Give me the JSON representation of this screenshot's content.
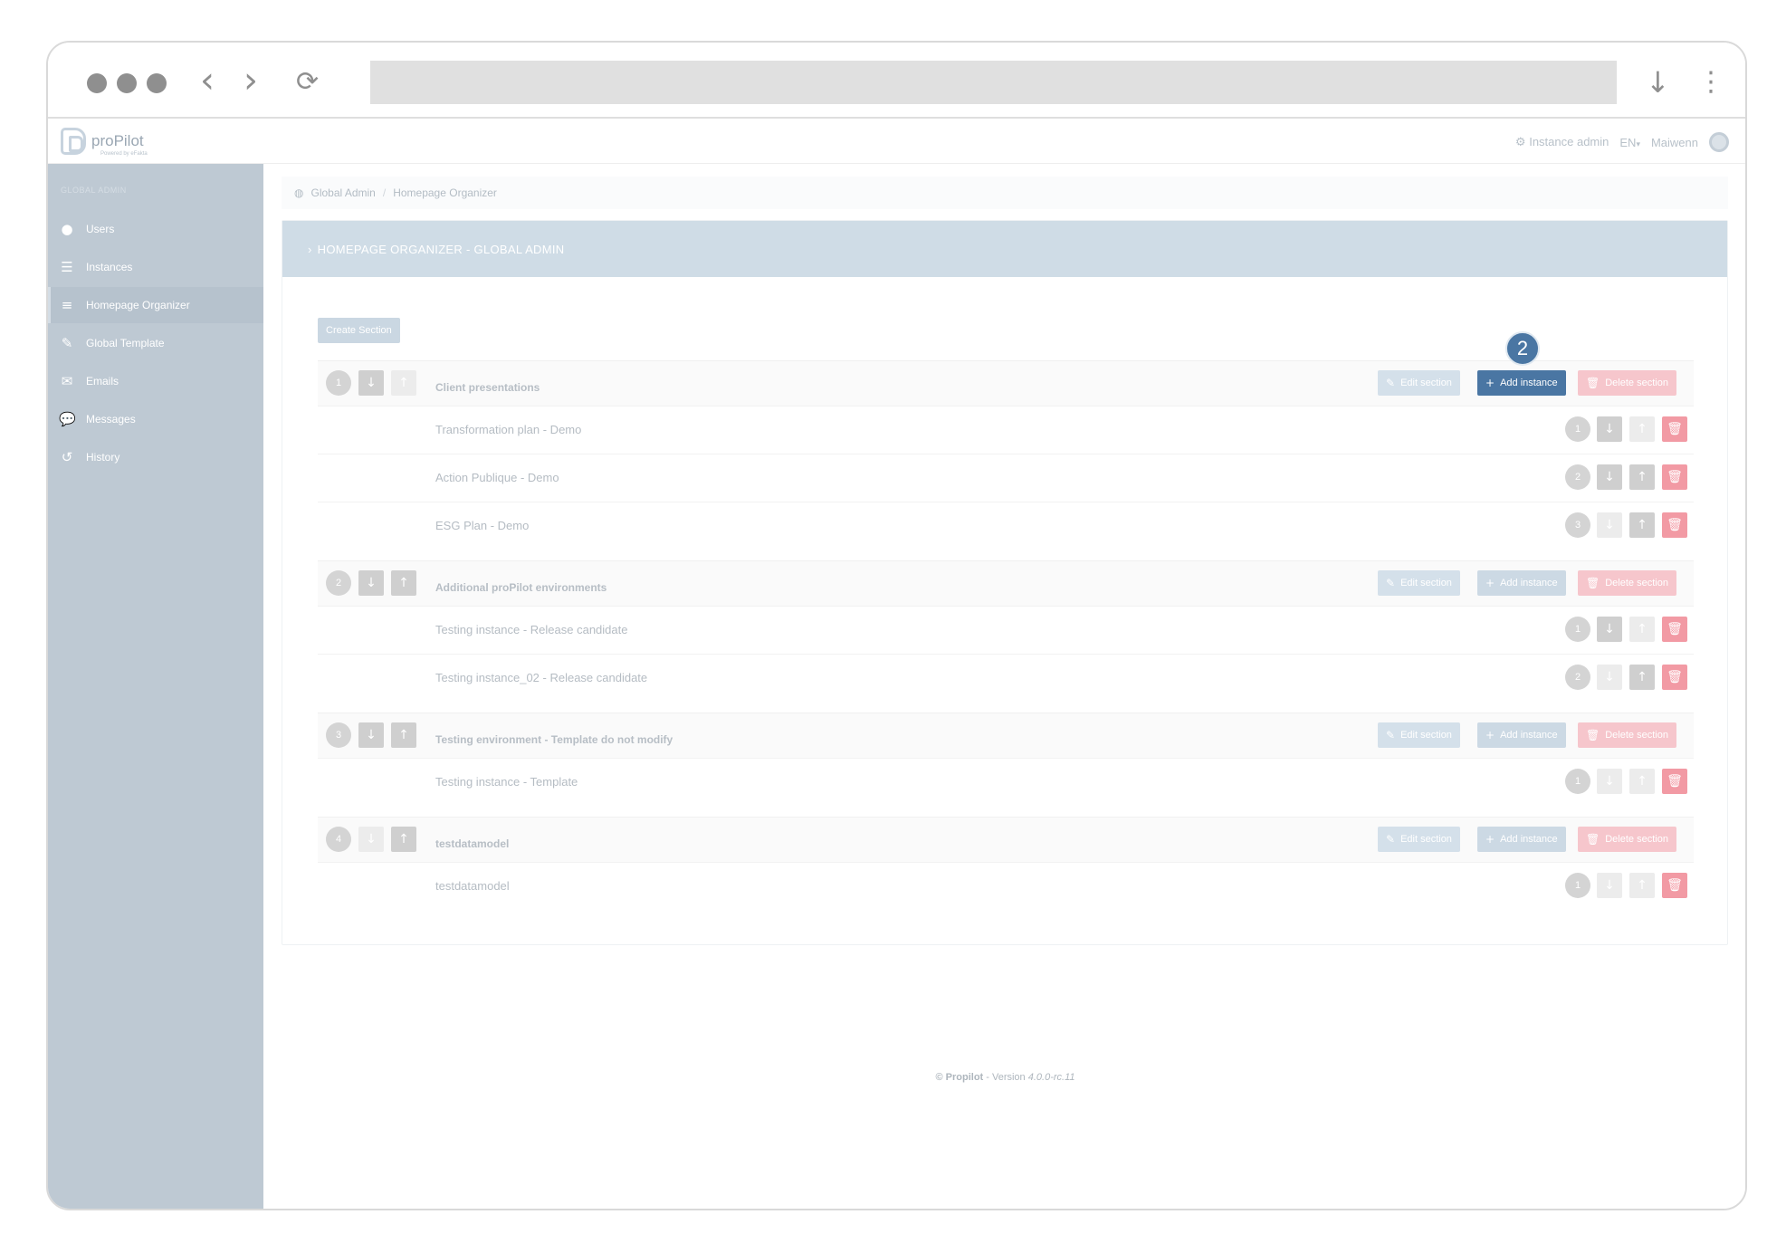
{
  "app": {
    "logo_text": "proPilot",
    "logo_sub": "Powered by eFakta",
    "topbar": {
      "admin_label": "Instance admin",
      "lang": "EN",
      "user": "Maiwenn"
    }
  },
  "sidebar": {
    "heading": "GLOBAL ADMIN",
    "items": [
      {
        "label": "Users",
        "icon": "user-icon"
      },
      {
        "label": "Instances",
        "icon": "list-icon"
      },
      {
        "label": "Homepage Organizer",
        "icon": "bars-icon"
      },
      {
        "label": "Global Template",
        "icon": "brush-icon"
      },
      {
        "label": "Emails",
        "icon": "envelope-icon"
      },
      {
        "label": "Messages",
        "icon": "comment-icon"
      },
      {
        "label": "History",
        "icon": "history-icon"
      }
    ]
  },
  "breadcrumb": {
    "root": "Global Admin",
    "sep": "/",
    "current": "Homepage Organizer"
  },
  "panel": {
    "title": "HOMEPAGE ORGANIZER - GLOBAL ADMIN",
    "create_label": "Create Section"
  },
  "actions": {
    "edit": "Edit section",
    "add": "Add instance",
    "delete": "Delete section"
  },
  "callout": "2",
  "sections": [
    {
      "num": "1",
      "title": "Client presentations",
      "instances": [
        {
          "num": "1",
          "name": "Transformation plan - Demo"
        },
        {
          "num": "2",
          "name": "Action Publique - Demo"
        },
        {
          "num": "3",
          "name": "ESG Plan - Demo"
        }
      ]
    },
    {
      "num": "2",
      "title": "Additional proPilot environments",
      "instances": [
        {
          "num": "1",
          "name": "Testing instance - Release candidate"
        },
        {
          "num": "2",
          "name": "Testing instance_02 - Release candidate"
        }
      ]
    },
    {
      "num": "3",
      "title": "Testing environment - Template do not modify",
      "instances": [
        {
          "num": "1",
          "name": "Testing instance - Template"
        }
      ]
    },
    {
      "num": "4",
      "title": "testdatamodel",
      "instances": [
        {
          "num": "1",
          "name": "testdatamodel"
        }
      ]
    }
  ],
  "footer": {
    "copy": "© Propilot",
    "sep": " - Version ",
    "version": "4.0.0-rc.11"
  },
  "colors": {
    "accent": "#4a76a3",
    "sidebar": "#bec9d3",
    "panel_head": "#cfdce6",
    "danger": "#f29aa4"
  }
}
